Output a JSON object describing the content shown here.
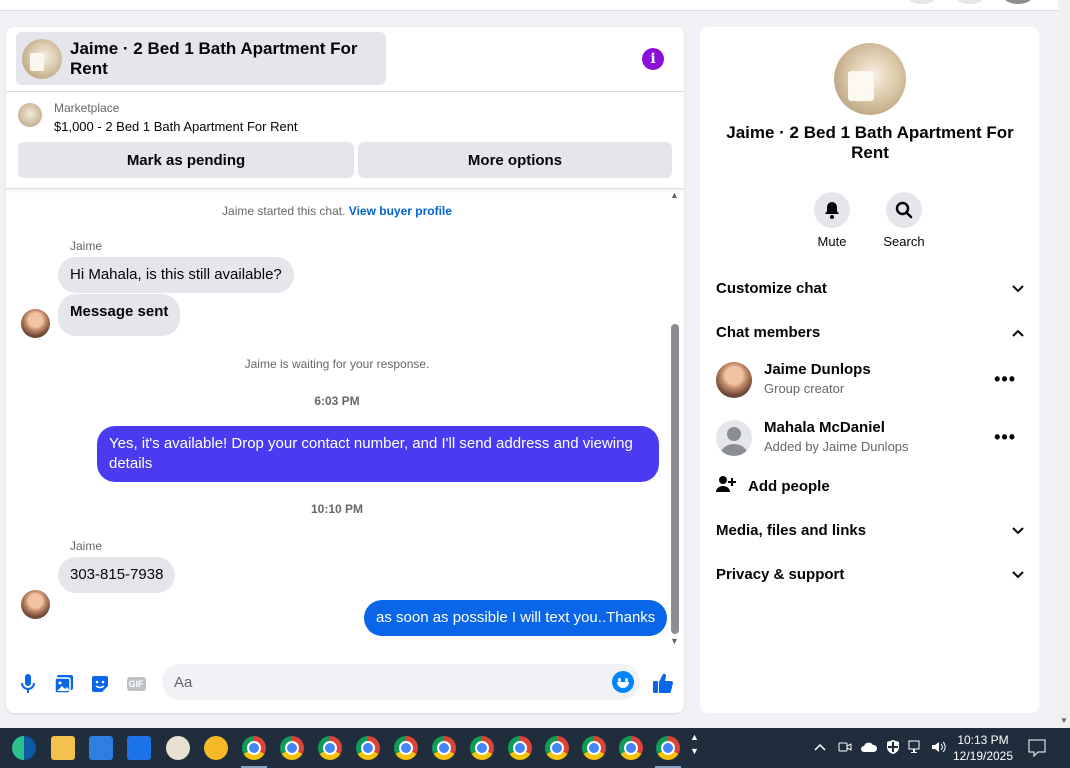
{
  "header": {
    "title": "Jaime · 2 Bed 1 Bath Apartment For Rent",
    "info_icon": "info-icon"
  },
  "listing": {
    "source": "Marketplace",
    "price_title": "$1,000 - 2 Bed 1 Bath Apartment For Rent",
    "mark_pending_label": "Mark as pending",
    "more_options_label": "More options"
  },
  "messages": {
    "started_text": "Jaime started this chat.",
    "view_profile_link": "View buyer profile",
    "sender_1": "Jaime",
    "msg_1": "Hi Mahala, is this still available?",
    "msg_2": "Message sent",
    "waiting_text": "Jaime is waiting for your response.",
    "time_1": "6:03 PM",
    "msg_3": "Yes, it's available! Drop your contact number, and I'll send address and viewing details",
    "time_2": "10:10 PM",
    "sender_2": "Jaime",
    "msg_4": "303-815-7938",
    "msg_5": "as soon as possible I will text you..Thanks"
  },
  "composer": {
    "placeholder": "Aa",
    "icons": [
      "microphone-icon",
      "photo-icon",
      "sticker-icon",
      "gif-icon",
      "emoji-icon",
      "thumbs-up-icon"
    ],
    "gif_label": "GIF"
  },
  "info_panel": {
    "name": "Jaime · 2 Bed 1 Bath Apartment For Rent",
    "mute_label": "Mute",
    "search_label": "Search",
    "customize_label": "Customize chat",
    "members_label": "Chat members",
    "members": [
      {
        "name": "Jaime Dunlops",
        "role": "Group creator"
      },
      {
        "name": "Mahala McDaniel",
        "role": "Added by Jaime Dunlops"
      }
    ],
    "more_dots": "•••",
    "add_people_label": "Add people",
    "media_label": "Media, files and links",
    "privacy_label": "Privacy & support"
  },
  "colors": {
    "outgoing_purple": "#4a3bf0",
    "outgoing_blue": "#0a66e8",
    "link_blue": "#0064d1",
    "info_purple": "#8a0fd8",
    "taskbar": "#1f2d3d"
  },
  "taskbar": {
    "time": "10:13 PM",
    "date": "12/19/2025"
  }
}
